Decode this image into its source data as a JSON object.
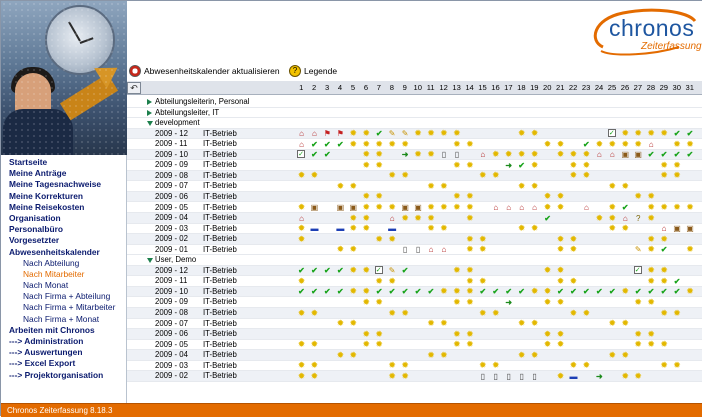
{
  "app": {
    "logo_text": "chronos",
    "logo_subtitle": "Zeiterfassung",
    "status_text": "Chronos Zeiterfassung 8.18.3",
    "colors": {
      "brand_orange": "#e36b00",
      "brand_blue": "#1e56a0",
      "menu_text": "#0a1a6e",
      "menu_active": "#e36b00"
    }
  },
  "toolbar": {
    "refresh_label": "Abwesenheitskalender aktualisieren",
    "legend_label": "Legende",
    "refresh_icon": "calendar-refresh-icon",
    "legend_icon": "help-icon"
  },
  "menu": [
    {
      "label": "Startseite",
      "sub": false,
      "active": false
    },
    {
      "label": "Meine Anträge",
      "sub": false,
      "active": false
    },
    {
      "label": "Meine Tagesnachweise",
      "sub": false,
      "active": false
    },
    {
      "label": "Meine Korrekturen",
      "sub": false,
      "active": false
    },
    {
      "label": "Meine Reisekosten",
      "sub": false,
      "active": false
    },
    {
      "label": "Organisation",
      "sub": false,
      "active": false
    },
    {
      "label": "Personalbüro",
      "sub": false,
      "active": false
    },
    {
      "label": "Vorgesetzter",
      "sub": false,
      "active": false
    },
    {
      "label": "Abwesenheitskalender",
      "sub": false,
      "active": false
    },
    {
      "label": "Nach Abteilung",
      "sub": true,
      "active": false
    },
    {
      "label": "Nach Mitarbeiter",
      "sub": true,
      "active": true
    },
    {
      "label": "Nach Monat",
      "sub": true,
      "active": false
    },
    {
      "label": "Nach Firma + Abteilung",
      "sub": true,
      "active": false
    },
    {
      "label": "Nach Firma + Mitarbeiter",
      "sub": true,
      "active": false
    },
    {
      "label": "Nach Firma + Monat",
      "sub": true,
      "active": false
    },
    {
      "label": "Arbeiten mit Chronos",
      "sub": false,
      "active": false
    },
    {
      "label": "---> Administration",
      "sub": false,
      "active": false
    },
    {
      "label": "---> Auswertungen",
      "sub": false,
      "active": false
    },
    {
      "label": "---> Excel Export",
      "sub": false,
      "active": false
    },
    {
      "label": "---> Projektorganisation",
      "sub": false,
      "active": false
    }
  ],
  "days": [
    "1",
    "2",
    "3",
    "4",
    "5",
    "6",
    "7",
    "8",
    "9",
    "10",
    "11",
    "12",
    "13",
    "14",
    "15",
    "16",
    "17",
    "18",
    "19",
    "20",
    "21",
    "22",
    "23",
    "24",
    "25",
    "26",
    "27",
    "28",
    "29",
    "30",
    "31"
  ],
  "icons": {
    "s": {
      "glyph": "✹",
      "name": "weekend-sun-icon"
    },
    "c": {
      "glyph": "✔",
      "name": "approved-check-icon"
    },
    "b": {
      "glyph": "✓",
      "name": "checkbox-icon"
    },
    "a": {
      "glyph": "➜",
      "name": "arrow-icon"
    },
    "h": {
      "glyph": "⌂",
      "name": "house-icon"
    },
    "k": {
      "glyph": "▣",
      "name": "suitcase-icon"
    },
    "v": {
      "glyph": "▬",
      "name": "car-icon"
    },
    "o": {
      "glyph": "▯",
      "name": "book-icon"
    },
    "p": {
      "glyph": "✎",
      "name": "pen-icon"
    },
    "q": {
      "glyph": "?",
      "name": "question-icon"
    },
    "f": {
      "glyph": "⚑",
      "name": "flag-icon"
    }
  },
  "rows": [
    {
      "type": "group",
      "label": "Abteilungsleiterin, Personal",
      "expanded": false
    },
    {
      "type": "group",
      "label": "Abteilungsleiter, IT",
      "expanded": false
    },
    {
      "type": "group",
      "label": "development",
      "expanded": true
    },
    {
      "type": "month",
      "month": "2009 - 12",
      "dept": "IT-Betrieb",
      "cells": "hhffsscppssss....ss.....bsssscccc"
    },
    {
      "type": "month",
      "month": "2009 - 11",
      "dept": "IT-Betrieb",
      "cells": "hcccsssss...ss.....ss.cssssh.ssh"
    },
    {
      "type": "month",
      "month": "2009 - 10",
      "dept": "IT-Betrieb",
      "cells": "bcc..ss.assoo.hssss.ssshhkkcccc"
    },
    {
      "type": "month",
      "month": "2009 - 09",
      "dept": "IT-Betrieb",
      "cells": ".....ss.....ss..acs..ss.....ss."
    },
    {
      "type": "month",
      "month": "2009 - 08",
      "dept": "IT-Betrieb",
      "cells": "ss.....ss.....ss.....ss.....ss."
    },
    {
      "type": "month",
      "month": "2009 - 07",
      "dept": "IT-Betrieb",
      "cells": "...ss.....ss.....ss.....ss....."
    },
    {
      "type": "month",
      "month": "2009 - 06",
      "dept": "IT-Betrieb",
      "cells": ".....ss.....ss.....ss.....ss..."
    },
    {
      "type": "month",
      "month": "2009 - 05",
      "dept": "IT-Betrieb",
      "cells": "sk.kkssskkssss.hhhhss.h.sc.sssss"
    },
    {
      "type": "month",
      "month": "2009 - 04",
      "dept": "IT-Betrieb",
      "cells": "h...ss.hsss..s.....c...sshqs..."
    },
    {
      "type": "month",
      "month": "2009 - 03",
      "dept": "IT-Betrieb",
      "cells": "sv.vss.v..ss.....ss.....ss..hkk"
    },
    {
      "type": "month",
      "month": "2009 - 02",
      "dept": "IT-Betrieb",
      "cells": "s.....ss.....ss.....ss.....ss."
    },
    {
      "type": "month",
      "month": "2009 - 01",
      "dept": "IT-Betrieb",
      "cells": "...ss...oohh.ss.....ss....psc.s"
    },
    {
      "type": "group",
      "label": "User, Demo",
      "expanded": true
    },
    {
      "type": "month",
      "month": "2009 - 12",
      "dept": "IT-Betrieb",
      "cells": "ccccssbpc...ss.....ss.....bss..."
    },
    {
      "type": "month",
      "month": "2009 - 11",
      "dept": "IT-Betrieb",
      "cells": "s.....ss.....ss.....ss.....ssc."
    },
    {
      "type": "month",
      "month": "2009 - 10",
      "dept": "IT-Betrieb",
      "cells": "ccccsscccccsssccccsscccccsccccsss"
    },
    {
      "type": "month",
      "month": "2009 - 09",
      "dept": "IT-Betrieb",
      "cells": ".....ss.....ss..a..ss.....ss.."
    },
    {
      "type": "month",
      "month": "2009 - 08",
      "dept": "IT-Betrieb",
      "cells": "ss.....ss.....ss.....ss.....ss."
    },
    {
      "type": "month",
      "month": "2009 - 07",
      "dept": "IT-Betrieb",
      "cells": "...ss.....ss.....ss.....ss....."
    },
    {
      "type": "month",
      "month": "2009 - 06",
      "dept": "IT-Betrieb",
      "cells": ".....ss.....ss.....ss.....ss..."
    },
    {
      "type": "month",
      "month": "2009 - 05",
      "dept": "IT-Betrieb",
      "cells": "ss...ss.....ss.....ss.....sss."
    },
    {
      "type": "month",
      "month": "2009 - 04",
      "dept": "IT-Betrieb",
      "cells": "...ss.....ss.....ss.....ss...."
    },
    {
      "type": "month",
      "month": "2009 - 03",
      "dept": "IT-Betrieb",
      "cells": "ss.....ss.....ss.....ss.....ss."
    },
    {
      "type": "month",
      "month": "2009 - 02",
      "dept": "IT-Betrieb",
      "cells": "ss.....ss.....ooooo.sv.a.ss..."
    }
  ]
}
